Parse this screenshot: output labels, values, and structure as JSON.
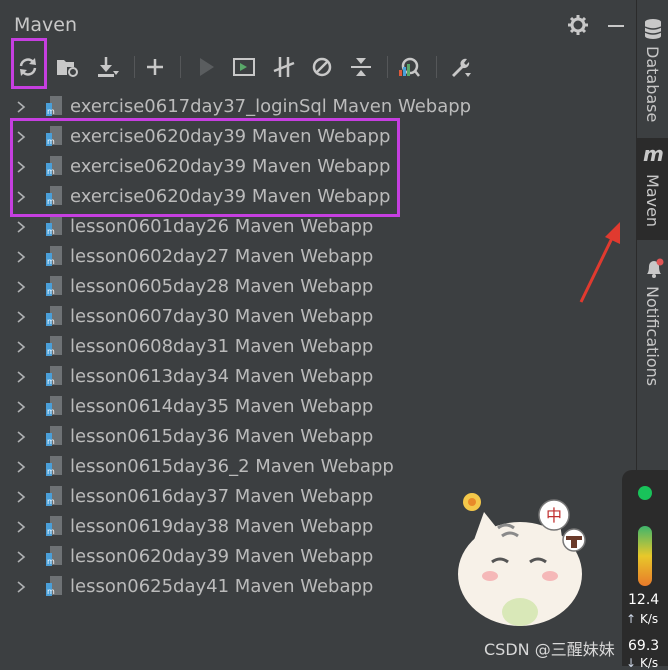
{
  "panel": {
    "title": "Maven"
  },
  "tree": {
    "items": [
      {
        "label": "exercise0617day37_loginSql Maven Webapp"
      },
      {
        "label": "exercise0620day39 Maven Webapp"
      },
      {
        "label": "exercise0620day39 Maven Webapp"
      },
      {
        "label": "exercise0620day39 Maven Webapp"
      },
      {
        "label": "lesson0601day26 Maven Webapp"
      },
      {
        "label": "lesson0602day27 Maven Webapp"
      },
      {
        "label": "lesson0605day28 Maven Webapp"
      },
      {
        "label": "lesson0607day30 Maven Webapp"
      },
      {
        "label": "lesson0608day31 Maven Webapp"
      },
      {
        "label": "lesson0613day34 Maven Webapp"
      },
      {
        "label": "lesson0614day35 Maven Webapp"
      },
      {
        "label": "lesson0615day36 Maven Webapp"
      },
      {
        "label": "lesson0615day36_2 Maven Webapp"
      },
      {
        "label": "lesson0616day37 Maven Webapp"
      },
      {
        "label": "lesson0619day38 Maven Webapp"
      },
      {
        "label": "lesson0620day39 Maven Webapp"
      },
      {
        "label": "lesson0625day41 Maven Webapp"
      }
    ]
  },
  "sidebar": {
    "database_label": "Database",
    "maven_label": "Maven",
    "maven_icon_text": "m",
    "notifications_label": "Notifications"
  },
  "speed_widget": {
    "upload_value": "12.4",
    "upload_unit": "K/s",
    "download_value": "69.3",
    "download_unit": "K/s"
  },
  "sticker": {
    "badge_text": "中"
  },
  "watermark": {
    "text": "CSDN @三醒妹妹"
  },
  "colors": {
    "background": "#3c3f41",
    "highlight": "#c63fe0",
    "arrow": "#e03a2f",
    "maven_icon": "#4a9fd8"
  }
}
